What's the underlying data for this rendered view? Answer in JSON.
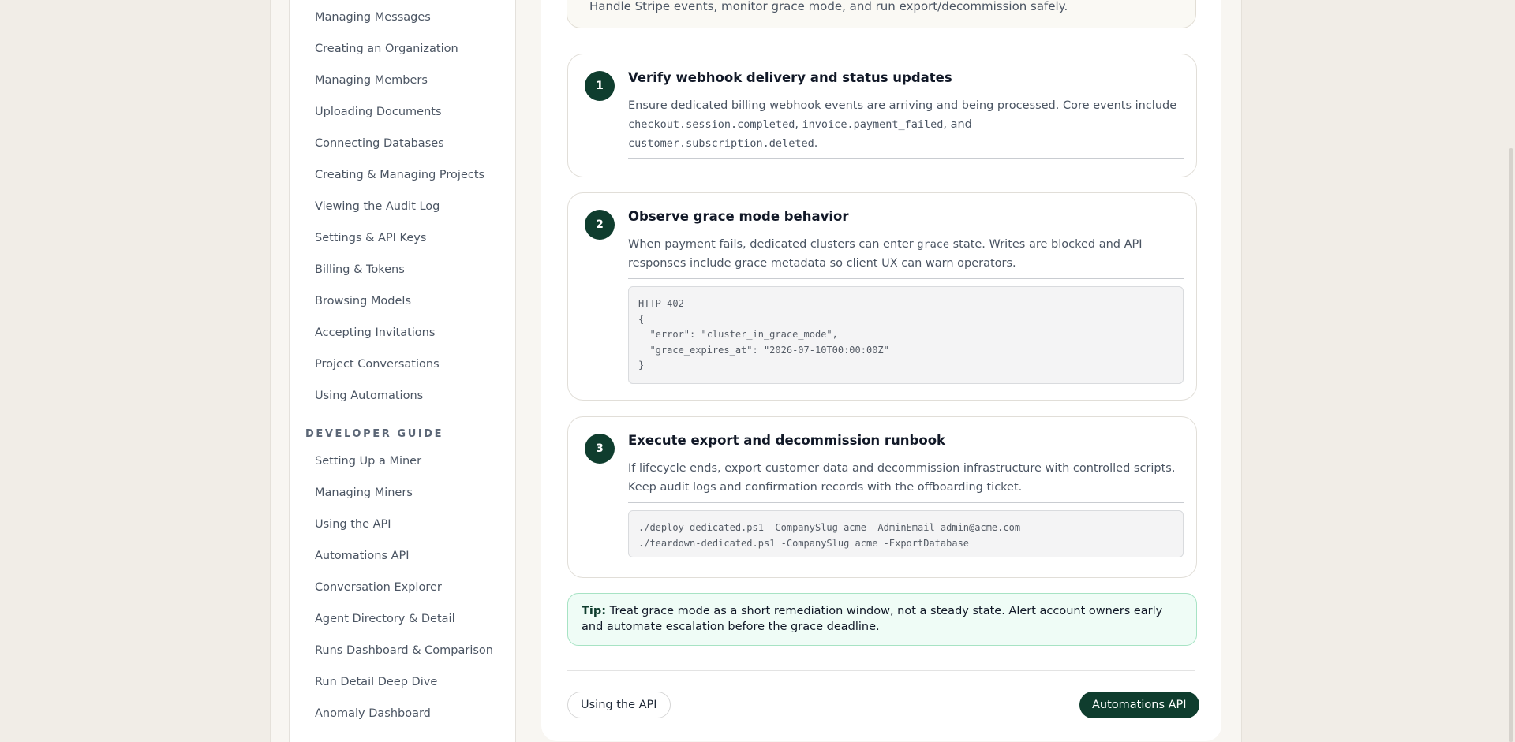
{
  "sidebar": {
    "items_top": [
      "Managing Messages",
      "Creating an Organization",
      "Managing Members",
      "Uploading Documents",
      "Connecting Databases",
      "Creating & Managing Projects",
      "Viewing the Audit Log",
      "Settings & API Keys",
      "Billing & Tokens",
      "Browsing Models",
      "Accepting Invitations",
      "Project Conversations",
      "Using Automations"
    ],
    "developer_section_title": "DEVELOPER GUIDE",
    "items_dev": [
      "Setting Up a Miner",
      "Managing Miners",
      "Using the API",
      "Automations API",
      "Conversation Explorer",
      "Agent Directory & Detail",
      "Runs Dashboard & Comparison",
      "Run Detail Deep Dive",
      "Anomaly Dashboard"
    ]
  },
  "intro": {
    "text": "Handle Stripe events, monitor grace mode, and run export/decommission safely."
  },
  "steps": [
    {
      "number": "1",
      "title": "Verify webhook delivery and status updates",
      "body_pre": "Ensure dedicated billing webhook events are arriving and being processed. Core events include ",
      "code1": "checkout.session.completed",
      "sep1": ", ",
      "code2": "invoice.payment_failed",
      "sep2": ", and",
      "code3": "customer.subscription.deleted",
      "end": "."
    },
    {
      "number": "2",
      "title": "Observe grace mode behavior",
      "body_pre": "When payment fails, dedicated clusters can enter ",
      "code1": "grace",
      "body_post": " state. Writes are blocked and API responses include grace metadata so client UX can warn operators.",
      "code_block": "HTTP 402\n{\n  \"error\": \"cluster_in_grace_mode\",\n  \"grace_expires_at\": \"2026-07-10T00:00:00Z\"\n}"
    },
    {
      "number": "3",
      "title": "Execute export and decommission runbook",
      "body": "If lifecycle ends, export customer data and decommission infrastructure with controlled scripts. Keep audit logs and confirmation records with the offboarding ticket.",
      "code_block": "./deploy-dedicated.ps1 -CompanySlug acme -AdminEmail admin@acme.com\n./teardown-dedicated.ps1 -CompanySlug acme -ExportDatabase"
    }
  ],
  "tip": {
    "label": "Tip:",
    "text": "Treat grace mode as a short remediation window, not a steady state. Alert account owners early and automate escalation before the grace deadline."
  },
  "pager": {
    "prev_label": "Using the API",
    "next_label": "Automations API"
  },
  "colors": {
    "accent": "#0f3d2e",
    "tip_bg": "#effcf6",
    "tip_border": "#a7e3c4"
  }
}
